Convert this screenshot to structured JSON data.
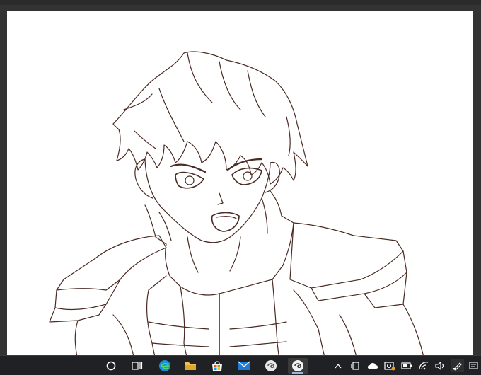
{
  "app": {
    "canvas_background": "#ffffff",
    "frame_color": "#333333",
    "line_color": "#4a2a22"
  },
  "taskbar": {
    "background": "#202124",
    "buttons": [
      {
        "name": "search-circle-button",
        "icon": "circle-icon"
      },
      {
        "name": "task-view-button",
        "icon": "task-view-icon"
      },
      {
        "name": "edge-browser-button",
        "icon": "edge-icon"
      },
      {
        "name": "file-explorer-button",
        "icon": "folder-icon"
      },
      {
        "name": "microsoft-store-button",
        "icon": "store-icon"
      },
      {
        "name": "mail-button",
        "icon": "mail-icon"
      },
      {
        "name": "paint-app-button",
        "icon": "swirl-icon"
      },
      {
        "name": "paint-app-active-button",
        "icon": "swirl-icon",
        "active": true
      }
    ],
    "tray": [
      {
        "name": "show-hidden-icons",
        "icon": "chevron-up-icon"
      },
      {
        "name": "device-tray-icon",
        "icon": "device-icon"
      },
      {
        "name": "onedrive-tray-icon",
        "icon": "cloud-icon"
      },
      {
        "name": "meet-now-tray-icon",
        "icon": "camera-icon"
      },
      {
        "name": "battery-tray-icon",
        "icon": "battery-icon"
      },
      {
        "name": "wifi-tray-icon",
        "icon": "wifi-icon"
      },
      {
        "name": "volume-tray-icon",
        "icon": "speaker-icon"
      },
      {
        "name": "pen-workspace-tray-icon",
        "icon": "pen-icon"
      },
      {
        "name": "notification-tray-icon",
        "icon": "notification-icon"
      }
    ]
  }
}
